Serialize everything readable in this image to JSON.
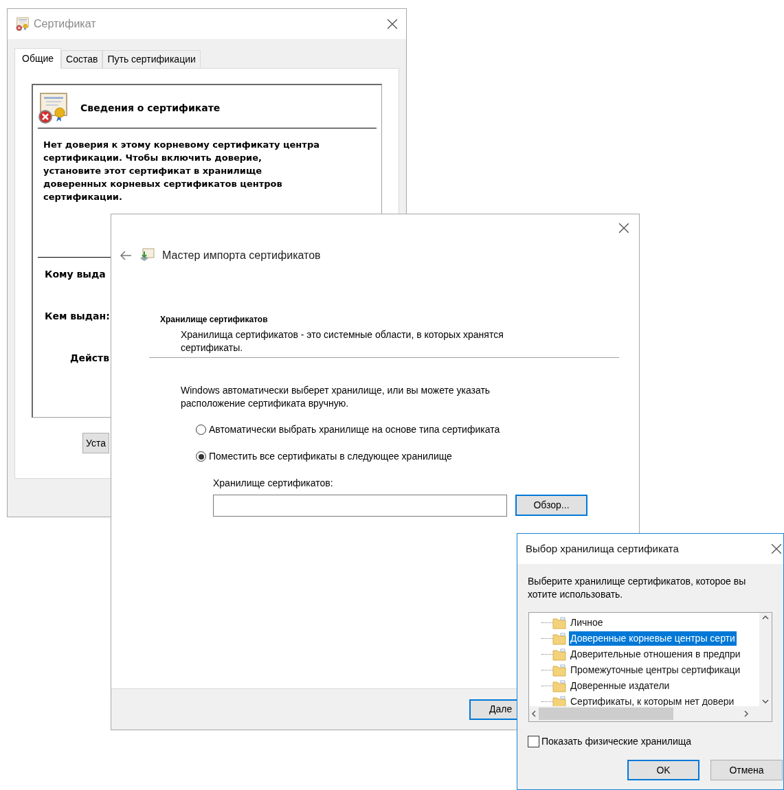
{
  "certificate_window": {
    "title": "Сертификат",
    "tabs": [
      {
        "label": "Общие",
        "selected": true
      },
      {
        "label": "Состав",
        "selected": false
      },
      {
        "label": "Путь сертификации",
        "selected": false
      }
    ],
    "info_title": "Сведения о сертификате",
    "warning": "Нет доверия к этому корневому сертификату центра сертификации. Чтобы включить  доверие, установите этот сертификат в хранилище доверенных корневых сертификатов центров сертификации.",
    "fields": [
      "Кому выда",
      "Кем выдан:",
      "Действ"
    ],
    "install_button": "Уста"
  },
  "import_wizard": {
    "title": "Мастер импорта сертификатов",
    "section_title": "Хранилище сертификатов",
    "section_description": "Хранилища сертификатов - это системные области, в которых хранятся сертификаты.",
    "intro": "Windows автоматически выберет хранилище, или вы можете указать расположение сертификата вручную.",
    "options": [
      {
        "label": "Автоматически выбрать хранилище на основе типа сертификата",
        "selected": false
      },
      {
        "label": "Поместить все сертификаты в следующее хранилище",
        "selected": true
      }
    ],
    "store_label": "Хранилище сертификатов:",
    "browse_button": "Обзор...",
    "next_button": "Дале"
  },
  "store_dialog": {
    "title": "Выбор хранилища сертификата",
    "prompt": "Выберите хранилище сертификатов, которое вы хотите использовать.",
    "stores": [
      {
        "label": "Личное",
        "selected": false
      },
      {
        "label": "Доверенные корневые центры серти",
        "selected": true
      },
      {
        "label": "Доверительные отношения в предпри",
        "selected": false
      },
      {
        "label": "Промежуточные центры сертификаци",
        "selected": false
      },
      {
        "label": "Доверенные издатели",
        "selected": false
      },
      {
        "label": "Сертификаты, к которым нет довери",
        "selected": false
      }
    ],
    "show_physical": {
      "label": "Показать физические хранилища",
      "checked": false
    },
    "ok_button": "OK",
    "cancel_button": "Отмена"
  }
}
